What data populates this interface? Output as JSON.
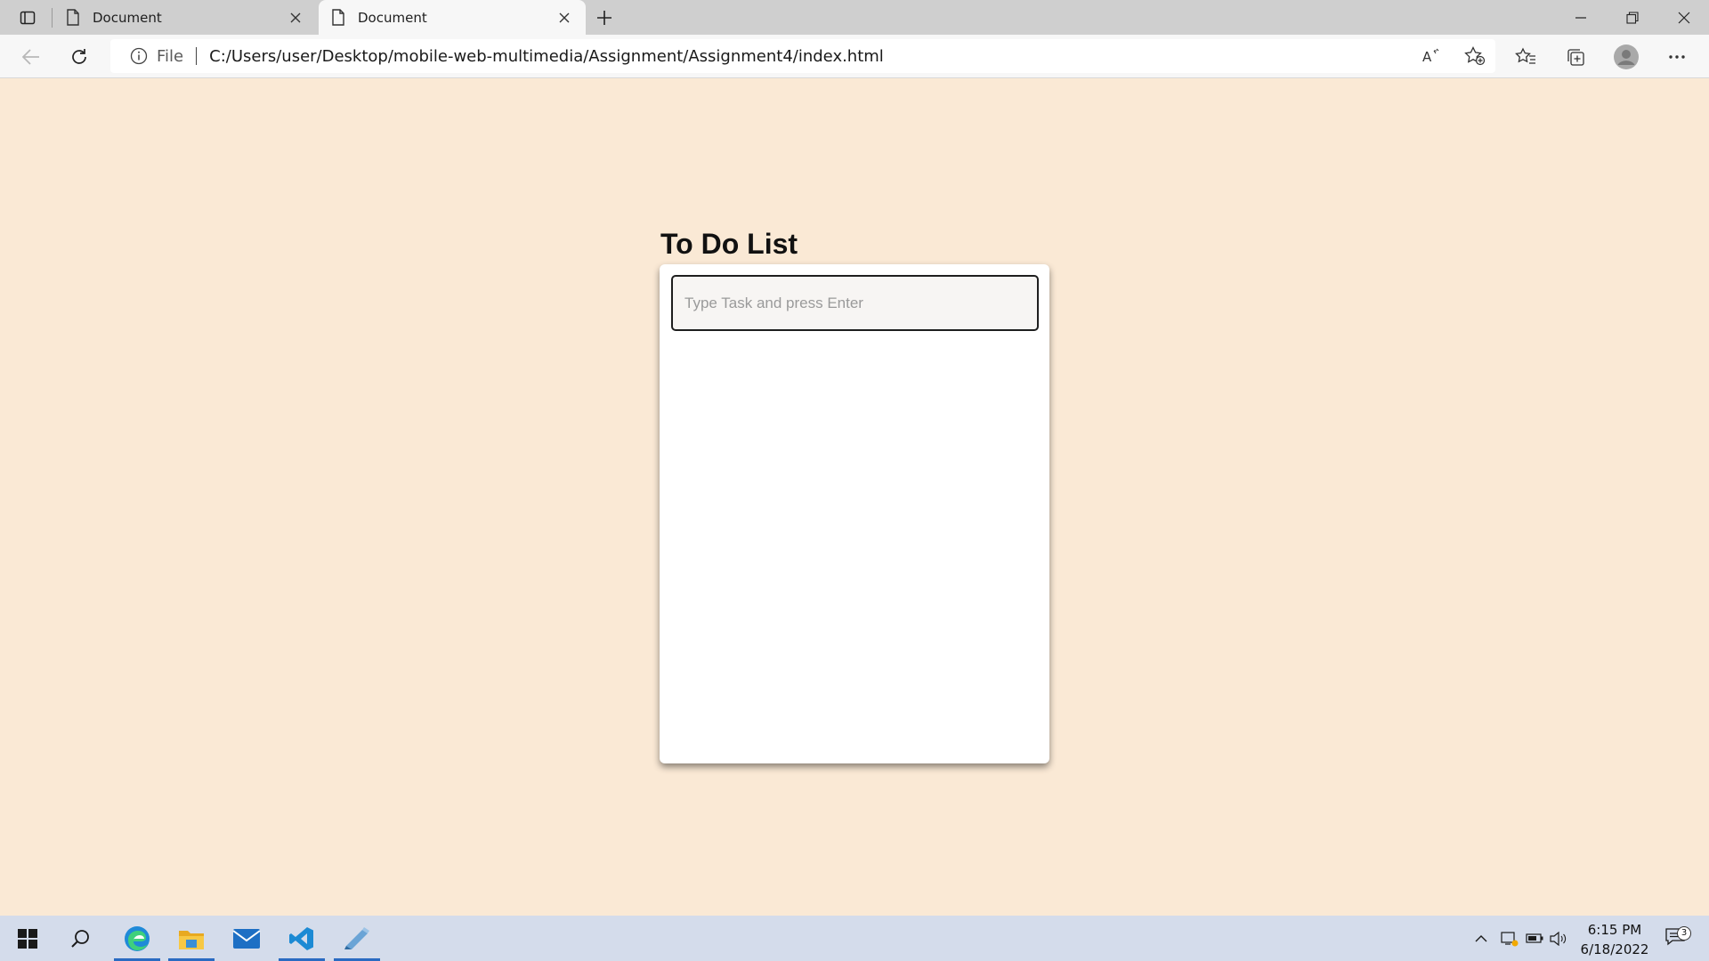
{
  "browser": {
    "tabs": [
      {
        "title": "Document",
        "active": false
      },
      {
        "title": "Document",
        "active": true
      }
    ],
    "address": {
      "scheme_label": "File",
      "url": "C:/Users/user/Desktop/mobile-web-multimedia/Assignment/Assignment4/index.html"
    }
  },
  "page": {
    "background_color": "#fae9d5",
    "title": "To Do List",
    "input": {
      "placeholder": "Type Task and press Enter",
      "value": ""
    },
    "tasks": []
  },
  "taskbar": {
    "apps": [
      "edge-icon",
      "file-explorer-icon",
      "mail-icon",
      "vscode-icon",
      "notepad-icon"
    ],
    "active_app": "edge-icon",
    "clock": {
      "time": "6:15 PM",
      "date": "6/18/2022"
    },
    "notification_count": "3"
  }
}
